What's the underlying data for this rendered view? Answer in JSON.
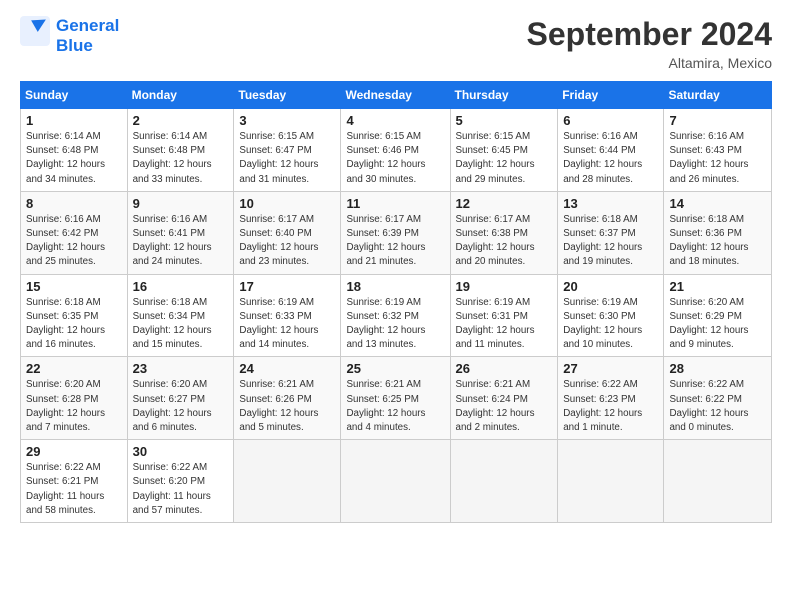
{
  "logo": {
    "line1": "General",
    "line2": "Blue"
  },
  "title": "September 2024",
  "subtitle": "Altamira, Mexico",
  "days_header": [
    "Sunday",
    "Monday",
    "Tuesday",
    "Wednesday",
    "Thursday",
    "Friday",
    "Saturday"
  ],
  "weeks": [
    [
      {
        "num": "1",
        "info": "Sunrise: 6:14 AM\nSunset: 6:48 PM\nDaylight: 12 hours\nand 34 minutes."
      },
      {
        "num": "2",
        "info": "Sunrise: 6:14 AM\nSunset: 6:48 PM\nDaylight: 12 hours\nand 33 minutes."
      },
      {
        "num": "3",
        "info": "Sunrise: 6:15 AM\nSunset: 6:47 PM\nDaylight: 12 hours\nand 31 minutes."
      },
      {
        "num": "4",
        "info": "Sunrise: 6:15 AM\nSunset: 6:46 PM\nDaylight: 12 hours\nand 30 minutes."
      },
      {
        "num": "5",
        "info": "Sunrise: 6:15 AM\nSunset: 6:45 PM\nDaylight: 12 hours\nand 29 minutes."
      },
      {
        "num": "6",
        "info": "Sunrise: 6:16 AM\nSunset: 6:44 PM\nDaylight: 12 hours\nand 28 minutes."
      },
      {
        "num": "7",
        "info": "Sunrise: 6:16 AM\nSunset: 6:43 PM\nDaylight: 12 hours\nand 26 minutes."
      }
    ],
    [
      {
        "num": "8",
        "info": "Sunrise: 6:16 AM\nSunset: 6:42 PM\nDaylight: 12 hours\nand 25 minutes."
      },
      {
        "num": "9",
        "info": "Sunrise: 6:16 AM\nSunset: 6:41 PM\nDaylight: 12 hours\nand 24 minutes."
      },
      {
        "num": "10",
        "info": "Sunrise: 6:17 AM\nSunset: 6:40 PM\nDaylight: 12 hours\nand 23 minutes."
      },
      {
        "num": "11",
        "info": "Sunrise: 6:17 AM\nSunset: 6:39 PM\nDaylight: 12 hours\nand 21 minutes."
      },
      {
        "num": "12",
        "info": "Sunrise: 6:17 AM\nSunset: 6:38 PM\nDaylight: 12 hours\nand 20 minutes."
      },
      {
        "num": "13",
        "info": "Sunrise: 6:18 AM\nSunset: 6:37 PM\nDaylight: 12 hours\nand 19 minutes."
      },
      {
        "num": "14",
        "info": "Sunrise: 6:18 AM\nSunset: 6:36 PM\nDaylight: 12 hours\nand 18 minutes."
      }
    ],
    [
      {
        "num": "15",
        "info": "Sunrise: 6:18 AM\nSunset: 6:35 PM\nDaylight: 12 hours\nand 16 minutes."
      },
      {
        "num": "16",
        "info": "Sunrise: 6:18 AM\nSunset: 6:34 PM\nDaylight: 12 hours\nand 15 minutes."
      },
      {
        "num": "17",
        "info": "Sunrise: 6:19 AM\nSunset: 6:33 PM\nDaylight: 12 hours\nand 14 minutes."
      },
      {
        "num": "18",
        "info": "Sunrise: 6:19 AM\nSunset: 6:32 PM\nDaylight: 12 hours\nand 13 minutes."
      },
      {
        "num": "19",
        "info": "Sunrise: 6:19 AM\nSunset: 6:31 PM\nDaylight: 12 hours\nand 11 minutes."
      },
      {
        "num": "20",
        "info": "Sunrise: 6:19 AM\nSunset: 6:30 PM\nDaylight: 12 hours\nand 10 minutes."
      },
      {
        "num": "21",
        "info": "Sunrise: 6:20 AM\nSunset: 6:29 PM\nDaylight: 12 hours\nand 9 minutes."
      }
    ],
    [
      {
        "num": "22",
        "info": "Sunrise: 6:20 AM\nSunset: 6:28 PM\nDaylight: 12 hours\nand 7 minutes."
      },
      {
        "num": "23",
        "info": "Sunrise: 6:20 AM\nSunset: 6:27 PM\nDaylight: 12 hours\nand 6 minutes."
      },
      {
        "num": "24",
        "info": "Sunrise: 6:21 AM\nSunset: 6:26 PM\nDaylight: 12 hours\nand 5 minutes."
      },
      {
        "num": "25",
        "info": "Sunrise: 6:21 AM\nSunset: 6:25 PM\nDaylight: 12 hours\nand 4 minutes."
      },
      {
        "num": "26",
        "info": "Sunrise: 6:21 AM\nSunset: 6:24 PM\nDaylight: 12 hours\nand 2 minutes."
      },
      {
        "num": "27",
        "info": "Sunrise: 6:22 AM\nSunset: 6:23 PM\nDaylight: 12 hours\nand 1 minute."
      },
      {
        "num": "28",
        "info": "Sunrise: 6:22 AM\nSunset: 6:22 PM\nDaylight: 12 hours\nand 0 minutes."
      }
    ],
    [
      {
        "num": "29",
        "info": "Sunrise: 6:22 AM\nSunset: 6:21 PM\nDaylight: 11 hours\nand 58 minutes."
      },
      {
        "num": "30",
        "info": "Sunrise: 6:22 AM\nSunset: 6:20 PM\nDaylight: 11 hours\nand 57 minutes."
      },
      {
        "num": "",
        "info": ""
      },
      {
        "num": "",
        "info": ""
      },
      {
        "num": "",
        "info": ""
      },
      {
        "num": "",
        "info": ""
      },
      {
        "num": "",
        "info": ""
      }
    ]
  ]
}
